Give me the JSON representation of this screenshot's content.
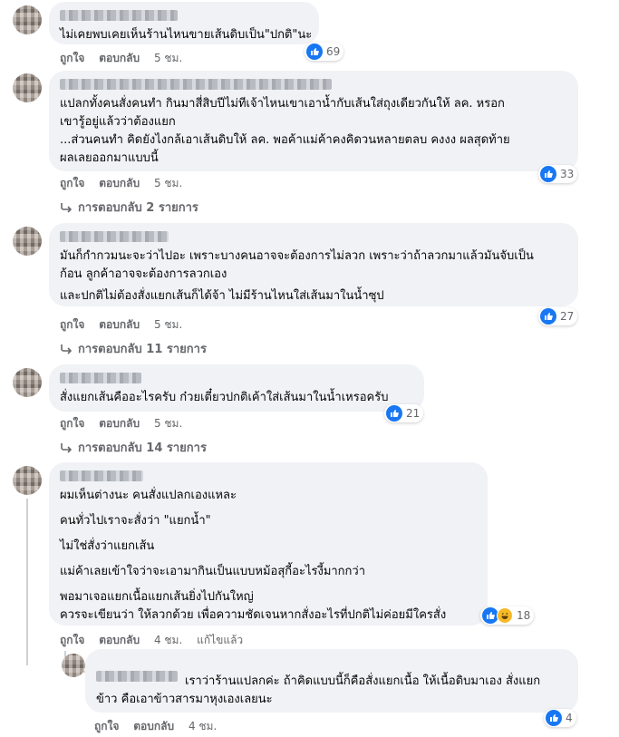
{
  "actions": {
    "like": "ถูกใจ",
    "reply": "ตอบกลับ",
    "edited": "แก้ไขแล้ว"
  },
  "colors": {
    "bubble": "#f0f2f5",
    "meta": "#65676b",
    "like": "#1877f2",
    "haha": "#f7b928"
  },
  "comments": [
    {
      "lines": [
        "ไม่เคยพบเคยเห็นร้านไหนขายเส้นดิบเป็น\"ปกติ\"นะ"
      ],
      "time": "5 ชม.",
      "reactions": {
        "icons": [
          "like-icon"
        ],
        "count": "69"
      }
    },
    {
      "lines": [
        "แปลกทั้งคนสั่งคนทำ กินมาสี่สิบปีไม่ทีเจ้าไหนเขาเอาน้ำกับเส้นใส่ถุงเดียวกันให้ ลค. หรอก",
        "เขารู้อยู่แล้วว่าต้องแยก",
        "...ส่วนคนทำ คิดยังไงกล้เอาเส้นดิบให้ ลค. พอค้าแม่ค้าคงคิดวนหลายตลบ คงงง ผลสุดท้าย",
        "ผลเลยออกมาแบบนี้"
      ],
      "time": "5 ชม.",
      "reactions": {
        "icons": [
          "like-icon"
        ],
        "count": "33"
      },
      "replies": "การตอบกลับ 2 รายการ"
    },
    {
      "lines": [
        "มันก็กำกวมนะจะว่าไปอะ เพราะบางคนอาจจะต้องการไม่ลวก เพราะว่าถ้าลวกมาแล้วมันจับเป็น",
        "ก้อน ลูกค้าอาจจะต้องการลวกเอง",
        "และปกติไม่ต้องสั่งแยกเส้นก็ได้จ้า ไม่มีร้านไหนใส่เส้นมาในน้ำซุป"
      ],
      "time": "5 ชม.",
      "reactions": {
        "icons": [
          "like-icon"
        ],
        "count": "27"
      },
      "replies": "การตอบกลับ 11 รายการ"
    },
    {
      "lines": [
        "สั่งแยกเส้นคืออะไรครับ ก๋วยเตี๋ยวปกติเค้าใส่เส้นมาในน้ำเหรอครับ"
      ],
      "time": "5 ชม.",
      "reactions": {
        "icons": [
          "like-icon"
        ],
        "count": "21"
      },
      "replies": "การตอบกลับ 14 รายการ"
    },
    {
      "lines": [
        "ผมเห็นต่างนะ คนสั่งแปลกเองแหละ",
        "คนทั่วไปเราจะสั่งว่า \"แยกน้ำ\"",
        "ไม่ใช่สั่งว่าแยกเส้น",
        "แม่ค้าเลยเข้าใจว่าจะเอามากินเป็นแบบหม้อสุกี้อะไรงี้มากกว่า",
        "พอมาเจอแยกเนื้อแยกเส้นยิ่งไปกันใหญ่",
        "ควรจะเขียนว่า ให้ลวกด้วย เพื่อความชัดเจนหากสั่งอะไรที่ปกติไม่ค่อยมีใครสั่ง"
      ],
      "time": "4 ชม.",
      "reactions": {
        "icons": [
          "like-icon",
          "haha-icon"
        ],
        "count": "18"
      }
    }
  ],
  "reply": {
    "lines": [
      "เราว่าร้านแปลกค่ะ ถ้าคิดแบบนี้ก็คือสั่งแยกเนื้อ ให้เนื้อดิบมาเอง สั่งแยก",
      "ข้าว คือเอาข้าวสารมาหุงเองเลยนะ"
    ],
    "time": "4 ชม.",
    "reactions": {
      "icons": [
        "like-icon"
      ],
      "count": "4"
    }
  }
}
